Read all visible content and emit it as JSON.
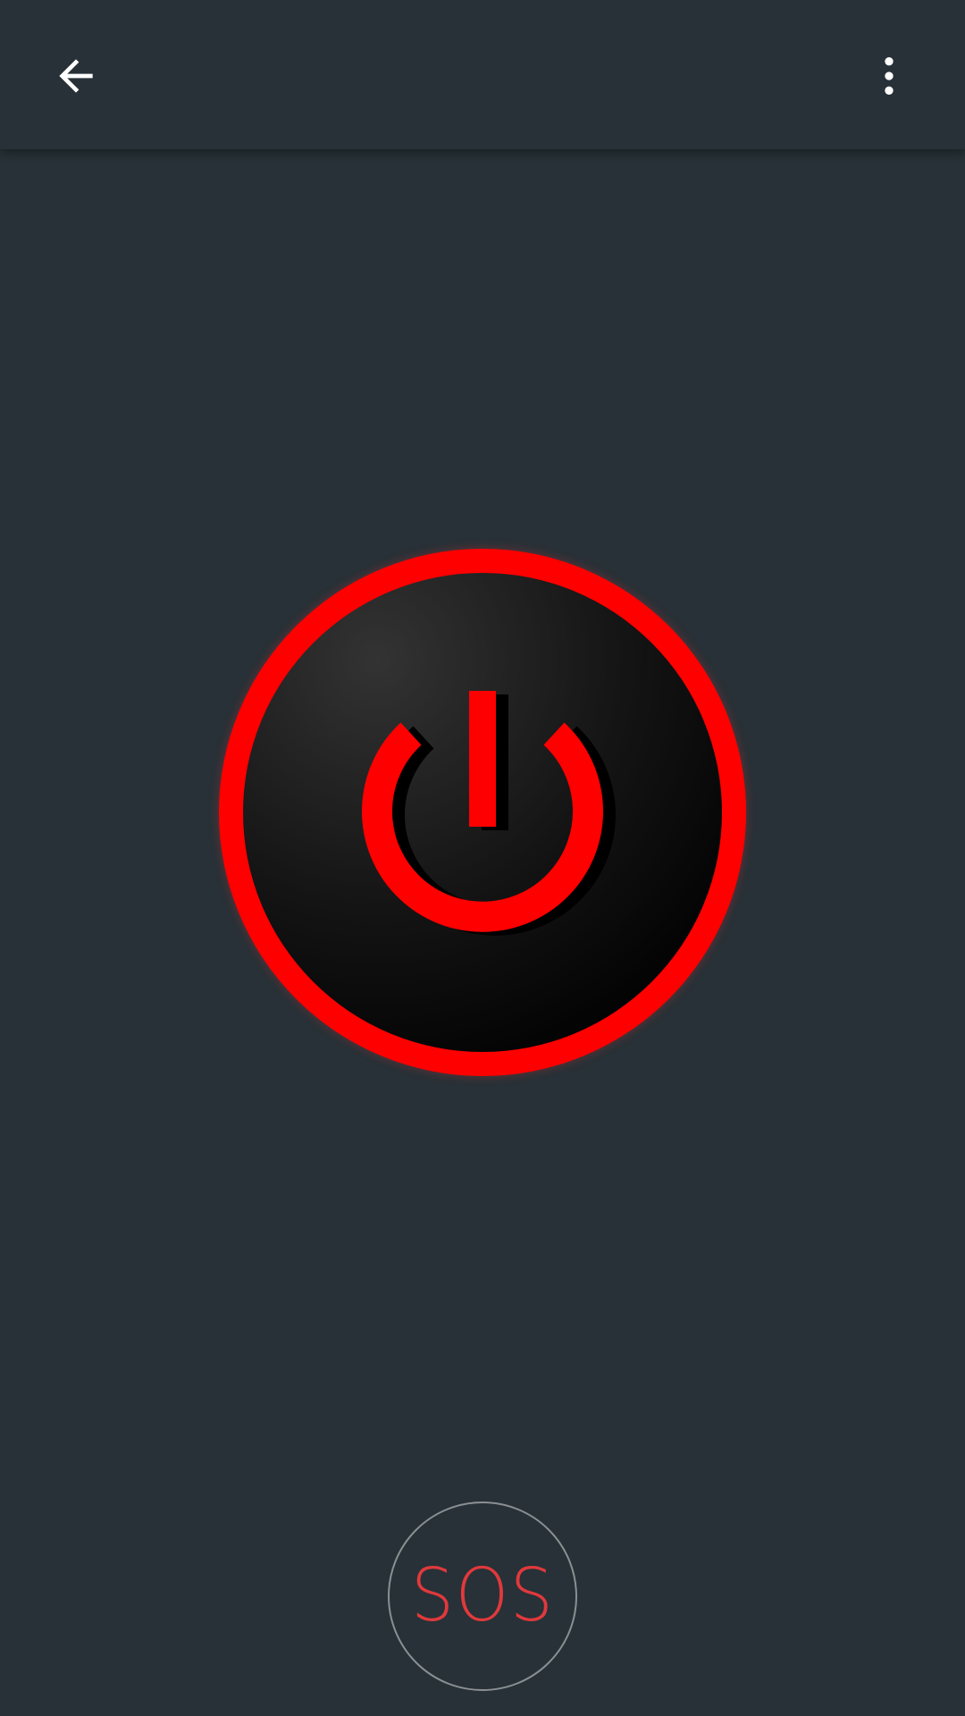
{
  "appbar": {
    "back_icon": "arrow-left-icon",
    "menu_icon": "more-vertical-icon"
  },
  "power": {
    "icon": "power-icon",
    "ring_color": "#ff0000",
    "symbol_color": "#ff0000"
  },
  "sos": {
    "label": "SOS",
    "label_color": "#e0393c"
  },
  "colors": {
    "background": "#273137",
    "icon_white": "#ffffff"
  }
}
